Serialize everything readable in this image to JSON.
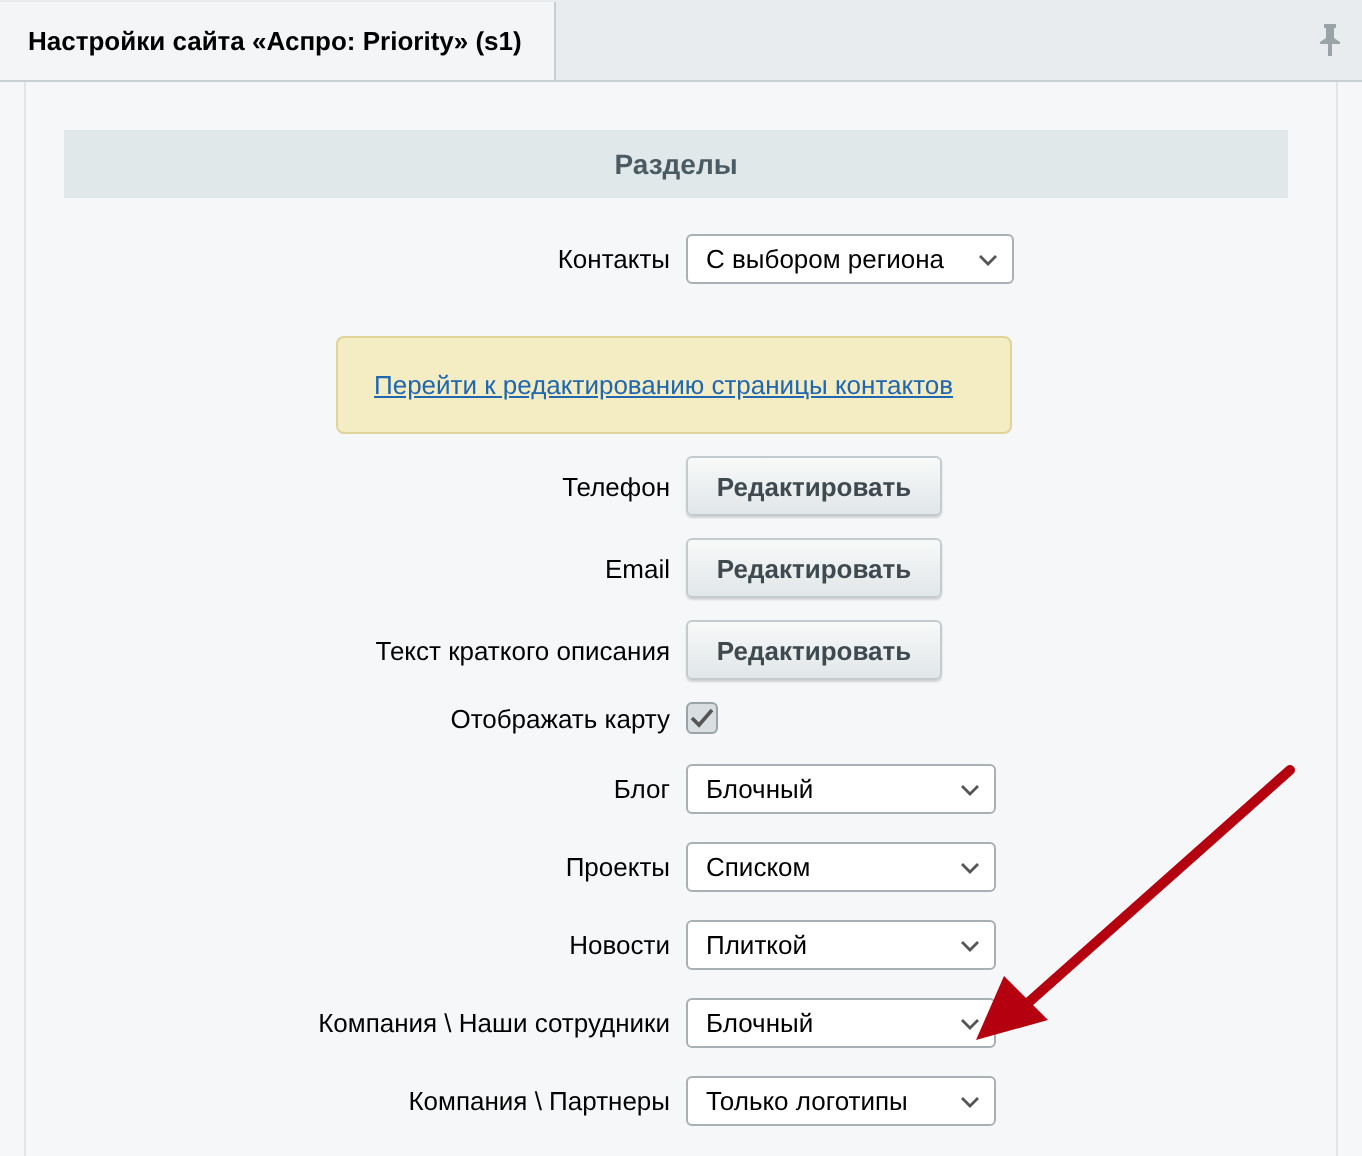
{
  "tab": {
    "title": "Настройки сайта «Аспро: Priority» (s1)",
    "selected": true
  },
  "section": {
    "title": "Разделы"
  },
  "rows": [
    {
      "kind": "select",
      "label": "Контакты",
      "value": "С выбором региона"
    },
    {
      "kind": "notice",
      "link": "Перейти к редактированию страницы контактов"
    },
    {
      "kind": "button",
      "label": "Телефон",
      "button": "Редактировать"
    },
    {
      "kind": "button",
      "label": "Email",
      "button": "Редактировать"
    },
    {
      "kind": "button",
      "label": "Текст краткого описания",
      "button": "Редактировать"
    },
    {
      "kind": "checkbox",
      "label": "Отображать карту",
      "checked": true
    },
    {
      "kind": "select",
      "label": "Блог",
      "value": "Блочный"
    },
    {
      "kind": "select",
      "label": "Проекты",
      "value": "Списком"
    },
    {
      "kind": "select",
      "label": "Новости",
      "value": "Плиткой"
    },
    {
      "kind": "select",
      "label": "Компания \\ Наши сотрудники",
      "value": "Блочный"
    },
    {
      "kind": "select",
      "label": "Компания \\ Партнеры",
      "value": "Только логотипы"
    }
  ]
}
